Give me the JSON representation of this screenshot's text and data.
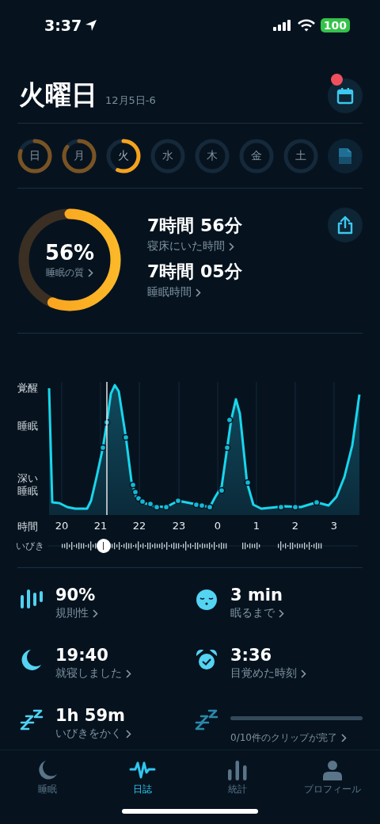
{
  "status_bar": {
    "time": "3:37",
    "battery": "100"
  },
  "header": {
    "title": "火曜日",
    "subtitle": "12月5日-6",
    "calendar_has_notification": true
  },
  "days": [
    {
      "label": "日",
      "selected": false
    },
    {
      "label": "月",
      "selected": false
    },
    {
      "label": "火",
      "selected": true
    },
    {
      "label": "水",
      "selected": false
    },
    {
      "label": "木",
      "selected": false
    },
    {
      "label": "金",
      "selected": false
    },
    {
      "label": "土",
      "selected": false
    }
  ],
  "summary": {
    "quality": {
      "value": "56%",
      "label": "睡眠の質"
    },
    "metrics": [
      {
        "value": "7時間 56分",
        "label": "寝床にいた時間"
      },
      {
        "value": "7時間 05分",
        "label": "睡眠時間"
      }
    ]
  },
  "sleep_chart": {
    "y_labels": [
      "覚醒",
      "睡眠",
      "深い睡眠"
    ],
    "x_title": "時間",
    "x_labels": [
      "20",
      "21",
      "22",
      "23",
      "0",
      "1",
      "2",
      "3"
    ],
    "snore_label": "いびき"
  },
  "stats": [
    {
      "kind": "value",
      "value": "90%",
      "label": "規則性"
    },
    {
      "kind": "value",
      "value": "3 min",
      "label": "眠るまで"
    },
    {
      "kind": "value",
      "value": "19:40",
      "label": "就寝しました"
    },
    {
      "kind": "value",
      "value": "3:36",
      "label": "目覚めた時刻"
    },
    {
      "kind": "value",
      "value": "1h 59m",
      "label": "いびきをかく"
    },
    {
      "kind": "progress",
      "level": 0,
      "label": "0/10件のクリップが完了"
    }
  ],
  "tab_bar": [
    {
      "label": "睡眠",
      "selected": false
    },
    {
      "label": "日誌",
      "selected": true
    },
    {
      "label": "統計",
      "selected": false
    },
    {
      "label": "プロフィール",
      "selected": false
    }
  ]
}
